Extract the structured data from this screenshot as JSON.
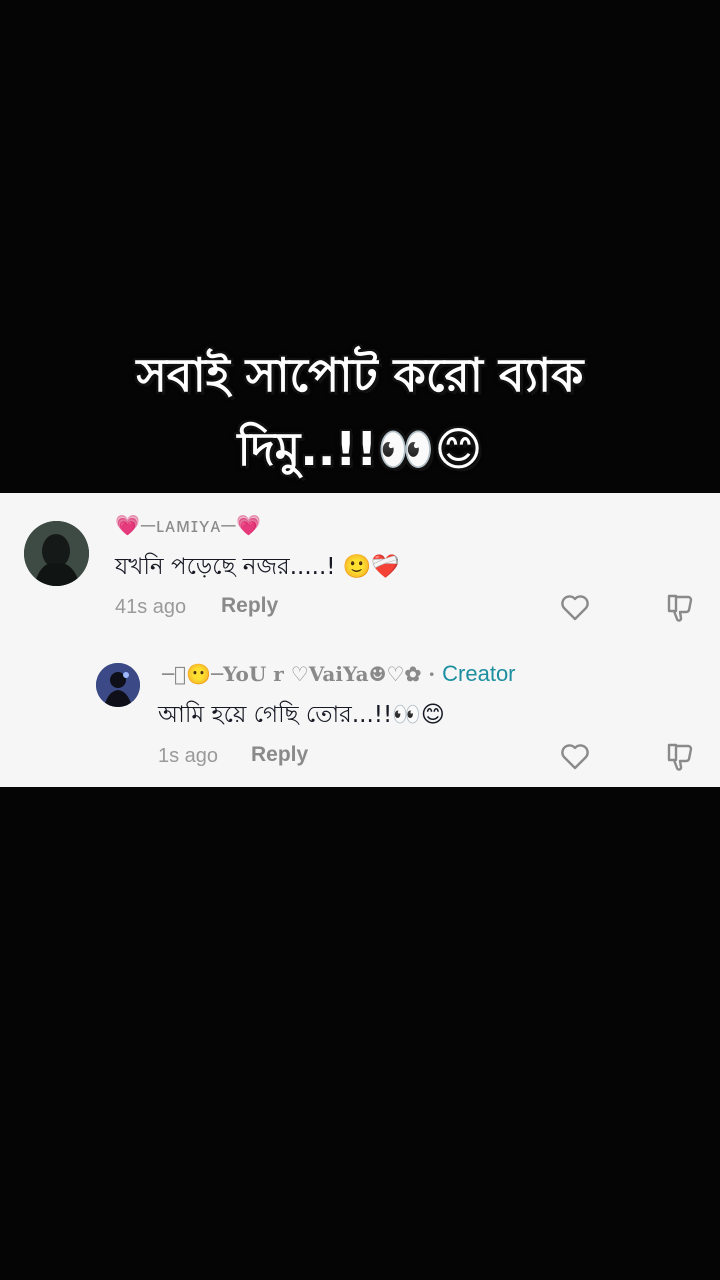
{
  "overlay": {
    "line1": "সবাই সাপোট করো ব্যাক",
    "line2": "দিমু..!!👀😊"
  },
  "comments": [
    {
      "username": "💗─ʟᴀᴍɪʏᴀ─💗",
      "text": "যখনি পড়েছে নজর.....! 🙂❤️‍🩹",
      "time": "41s ago",
      "reply_label": "Reply"
    },
    {
      "username": "─⃝😶─YoU r ♡VaiYa☻♡✿",
      "separator": " · ",
      "badge": "Creator",
      "text": "আমি হয়ে গেছি তোর...!!👀😊",
      "time": "1s ago",
      "reply_label": "Reply"
    }
  ],
  "icons": [
    "heart-icon",
    "dislike-icon"
  ]
}
